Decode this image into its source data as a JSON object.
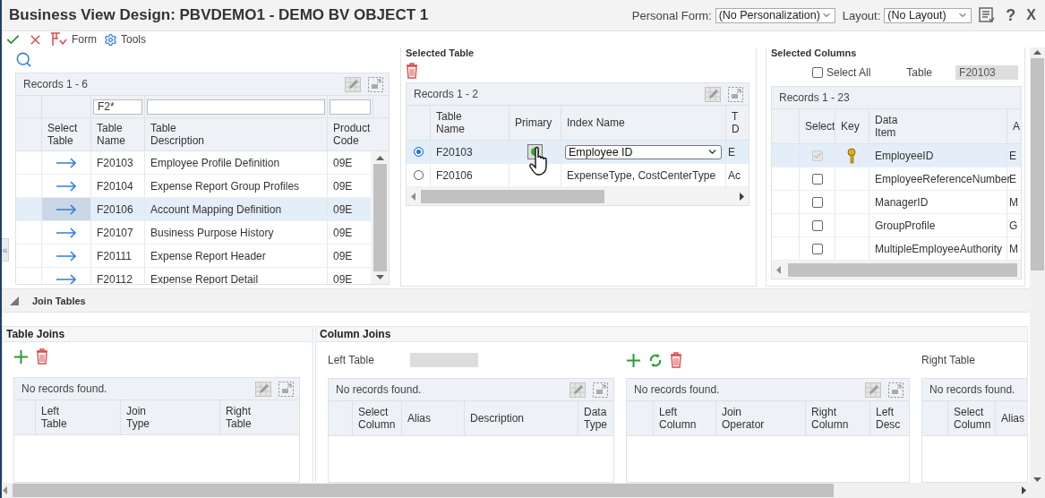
{
  "window": {
    "title": "Business View Design: PBVDEMO1 - DEMO BV OBJECT 1",
    "personal_form_label": "Personal Form:",
    "personal_form_value": "(No Personalization)",
    "layout_label": "Layout:",
    "layout_value": "(No Layout)",
    "help": "?",
    "close": "X"
  },
  "toolbar": {
    "menus": [
      "Form",
      "Tools"
    ]
  },
  "collapse": "«",
  "tables": {
    "records": "Records 1 - 6",
    "filter": "F2*",
    "columns": [
      "Select\nTable",
      "Table\nName",
      "Table\nDescription",
      "Product\nCode"
    ],
    "rows": [
      {
        "name": "F20103",
        "description": "Employee Profile Definition",
        "product_code": "09E",
        "selected": false
      },
      {
        "name": "F20104",
        "description": "Expense Report Group Profiles",
        "product_code": "09E",
        "selected": false
      },
      {
        "name": "F20106",
        "description": "Account Mapping Definition",
        "product_code": "09E",
        "selected": true
      },
      {
        "name": "F20107",
        "description": "Business Purpose History",
        "product_code": "09E",
        "selected": false
      },
      {
        "name": "F20111",
        "description": "Expense Report Header",
        "product_code": "09E",
        "selected": false
      },
      {
        "name": "F20112",
        "description": "Expense Report Detail",
        "product_code": "09E",
        "selected": false
      }
    ]
  },
  "selected_table": {
    "title": "Selected Table",
    "records": "Records 1 - 2",
    "columns": [
      "Table\nName",
      "Primary",
      "Index Name",
      "T\nD"
    ],
    "rows": [
      {
        "selected": true,
        "table_name": "F20103",
        "primary": true,
        "dropdown": true,
        "index_name": "Employee ID",
        "column_4": "E"
      },
      {
        "selected": false,
        "table_name": "F20106",
        "primary": false,
        "dropdown": false,
        "index_name": "ExpenseType, CostCenterType",
        "column_4": "Ac"
      }
    ]
  },
  "selected_columns": {
    "title": "Selected Columns",
    "select_all": {
      "label": "Select All",
      "checked": false
    },
    "table_label": "Table",
    "table_value": "F20103",
    "records": "Records 1 - 23",
    "columns": [
      "Select",
      "Key",
      "Data\nItem",
      "A"
    ],
    "rows": [
      {
        "selected": true,
        "checked": true,
        "disabled": true,
        "key": true,
        "data_item": "EmployeeID",
        "column_4": "E"
      },
      {
        "selected": false,
        "checked": false,
        "disabled": false,
        "key": false,
        "data_item": "EmployeeReferenceNumber",
        "column_4": "E"
      },
      {
        "selected": false,
        "checked": false,
        "disabled": false,
        "key": false,
        "data_item": "ManagerID",
        "column_4": "M"
      },
      {
        "selected": false,
        "checked": false,
        "disabled": false,
        "key": false,
        "data_item": "GroupProfile",
        "column_4": "G"
      },
      {
        "selected": false,
        "checked": false,
        "disabled": false,
        "key": false,
        "data_item": "MultipleEmployeeAuthority",
        "column_4": "M"
      }
    ]
  },
  "join_tables": {
    "title": "Join Tables",
    "expanded": true
  },
  "table_joins": {
    "title": "Table Joins",
    "status": "No records found.",
    "columns": [
      "Left\nTable",
      "Join\nType",
      "Right\nTable"
    ]
  },
  "column_joins": {
    "title": "Column Joins",
    "left": {
      "label": "Left Table",
      "status": "No records found.",
      "columns": [
        "Select\nColumn",
        "Alias",
        "Description",
        "Data\nType"
      ]
    },
    "joins": {
      "status": "No records found.",
      "columns": [
        "Left\nColumn",
        "Join\nOperator",
        "Right\nColumn",
        "Left\nDesc"
      ]
    },
    "right": {
      "label": "Right Table",
      "status": "No records found.",
      "columns": [
        "Select\nColumn",
        "Alias"
      ]
    }
  }
}
